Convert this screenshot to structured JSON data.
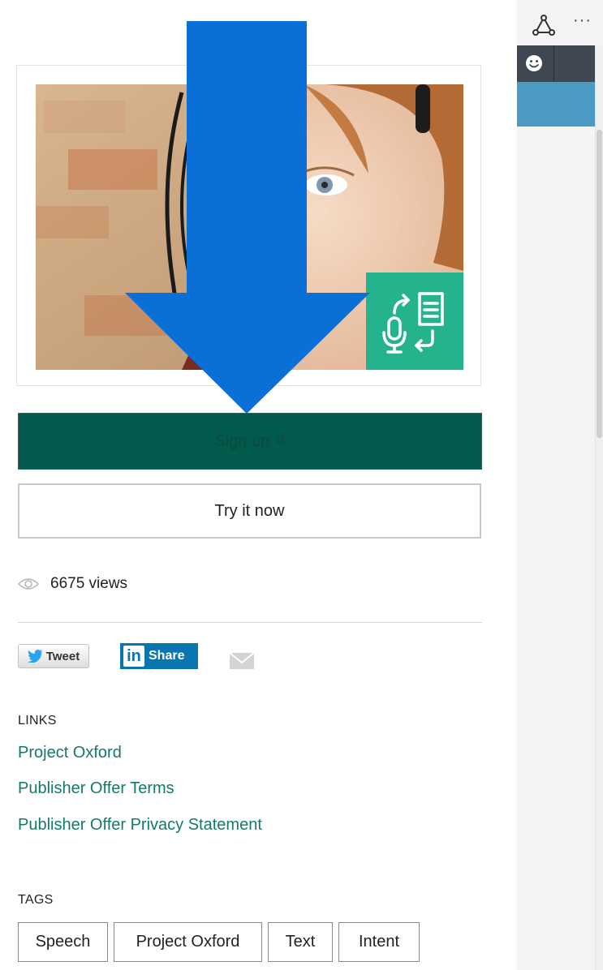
{
  "offer": {
    "signup_label": "Sign up",
    "signup_icon": "external-link-icon",
    "try_label": "Try it now",
    "views_text": "6675 views"
  },
  "share": {
    "tweet_label": "Tweet",
    "linkedin_logo": "in",
    "linkedin_label": "Share"
  },
  "links": {
    "title": "LINKS",
    "items": [
      "Project Oxford",
      "Publisher Offer Terms",
      "Publisher Offer Privacy Statement"
    ]
  },
  "tags": {
    "title": "TAGS",
    "items": [
      "Speech",
      "Project Oxford",
      "Text",
      "Intent"
    ]
  },
  "browser": {
    "more_label": "···",
    "icons": [
      "hub-icon",
      "smiley-icon"
    ]
  },
  "colors": {
    "signup_bg": "#025a4c",
    "tile_green": "#25b38e",
    "link_green": "#137a6b",
    "arrow_blue": "#0a6fd6",
    "linkedin_blue": "#0a76b1",
    "dark_bar": "#3e4752",
    "blue_bar": "#4b9ac4"
  }
}
